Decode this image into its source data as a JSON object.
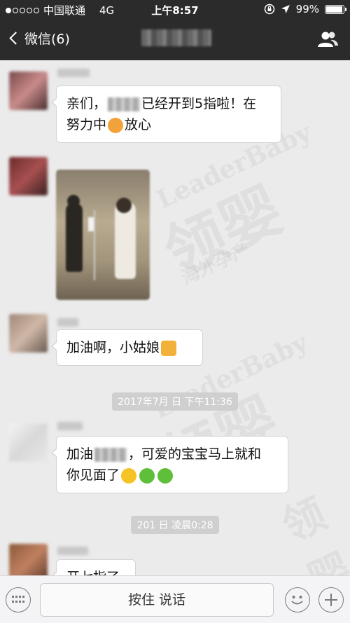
{
  "status_bar": {
    "carrier": "中国联通",
    "network": "4G",
    "time": "上午8:57",
    "battery": "99%",
    "battery_level": 0.99,
    "signal_bars_filled": 1
  },
  "nav": {
    "back_label": "微信(6)",
    "title": ""
  },
  "messages": [
    {
      "type": "text",
      "parts": [
        "亲们，",
        "已经开到5指啦！在",
        "努力中",
        "放心"
      ]
    },
    {
      "type": "image",
      "alt": ""
    },
    {
      "type": "text",
      "parts": [
        "加油啊，小姑娘"
      ]
    },
    {
      "type": "timestamp",
      "text": "2017年7月  日 下午11:36"
    },
    {
      "type": "text",
      "parts": [
        "加油",
        "，可爱的宝宝马上就和",
        "你见面了"
      ]
    },
    {
      "type": "timestamp",
      "text": "201       日 凌晨0:28"
    },
    {
      "type": "text",
      "parts": [
        "开七指了"
      ]
    }
  ],
  "input_bar": {
    "hold_to_talk": "按住 说话"
  },
  "watermark": {
    "brand_en": "LeaderBaby",
    "brand_cn": "领婴",
    "tagline": "海外孕产"
  },
  "colors": {
    "nav_bg": "#2b2b2b",
    "chat_bg": "#ebebeb",
    "bubble_bg": "#ffffff"
  }
}
